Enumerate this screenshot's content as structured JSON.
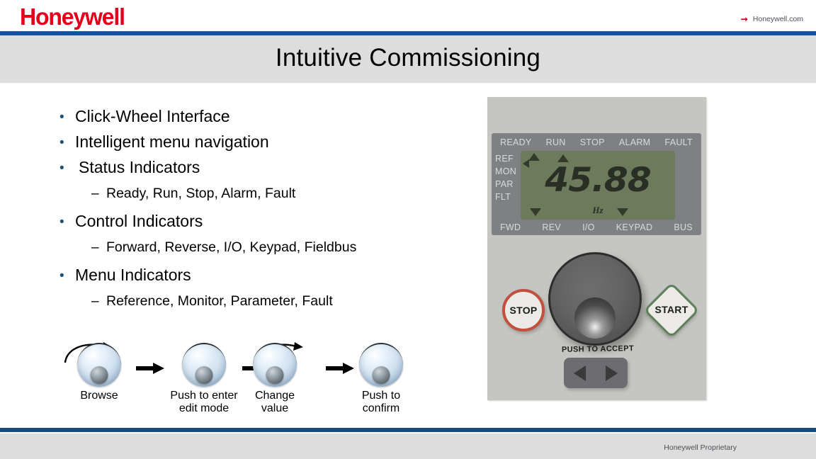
{
  "header": {
    "logo_text": "Honeywell",
    "logo_color": "#e3001b",
    "site_link_label": "Honeywell.com",
    "site_link_arrow_icon": "arrow-right-icon",
    "rule_color": "#13529c"
  },
  "title": {
    "text": "Intuitive Commissioning",
    "band_color": "#dddddd"
  },
  "bullets": [
    {
      "level": 1,
      "text": "Click-Wheel Interface"
    },
    {
      "level": 1,
      "text": "Intelligent menu navigation"
    },
    {
      "level": 1,
      "text": "Status Indicators",
      "extra_space": true
    },
    {
      "level": 2,
      "text": "Ready, Run, Stop, Alarm, Fault"
    },
    {
      "level": 1,
      "text": "Control Indicators"
    },
    {
      "level": 2,
      "text": "Forward, Reverse, I/O, Keypad, Fieldbus"
    },
    {
      "level": 1,
      "text": "Menu Indicators"
    },
    {
      "level": 2,
      "text": "Reference, Monitor, Parameter, Fault"
    }
  ],
  "bullet_marker": "•",
  "dash_marker": "–",
  "bullet_color": "#1f4e79",
  "steps": [
    {
      "label": "Browse",
      "rotate": true
    },
    {
      "label": "Push to enter\nedit mode",
      "rotate": false
    },
    {
      "label": "Change\nvalue",
      "rotate": true
    },
    {
      "label": "Push to\nconfirm",
      "rotate": false
    }
  ],
  "keypad": {
    "panel_color": "#c5c5c1",
    "bezel_color": "#7e8084",
    "lcd_color": "#6d7a5b",
    "status_top": [
      "READY",
      "RUN",
      "STOP",
      "ALARM",
      "FAULT"
    ],
    "status_bottom": [
      "FWD",
      "REV",
      "I/O",
      "KEYPAD",
      "BUS"
    ],
    "menu_column": [
      "REF",
      "MON",
      "PAR",
      "FLT"
    ],
    "lcd_value": "45.88",
    "lcd_unit": "Hz",
    "wheel_caption": "PUSH TO ACCEPT",
    "stop_label": "STOP",
    "start_label": "START",
    "stop_ring_color": "#c2503e",
    "start_ring_color": "#5f7f5b",
    "nav_left_icon": "triangle-left-icon",
    "nav_right_icon": "triangle-right-icon"
  },
  "footer": {
    "text": "Honeywell Proprietary",
    "rule_color": "#1b4a77",
    "band_color": "#dddddd"
  }
}
